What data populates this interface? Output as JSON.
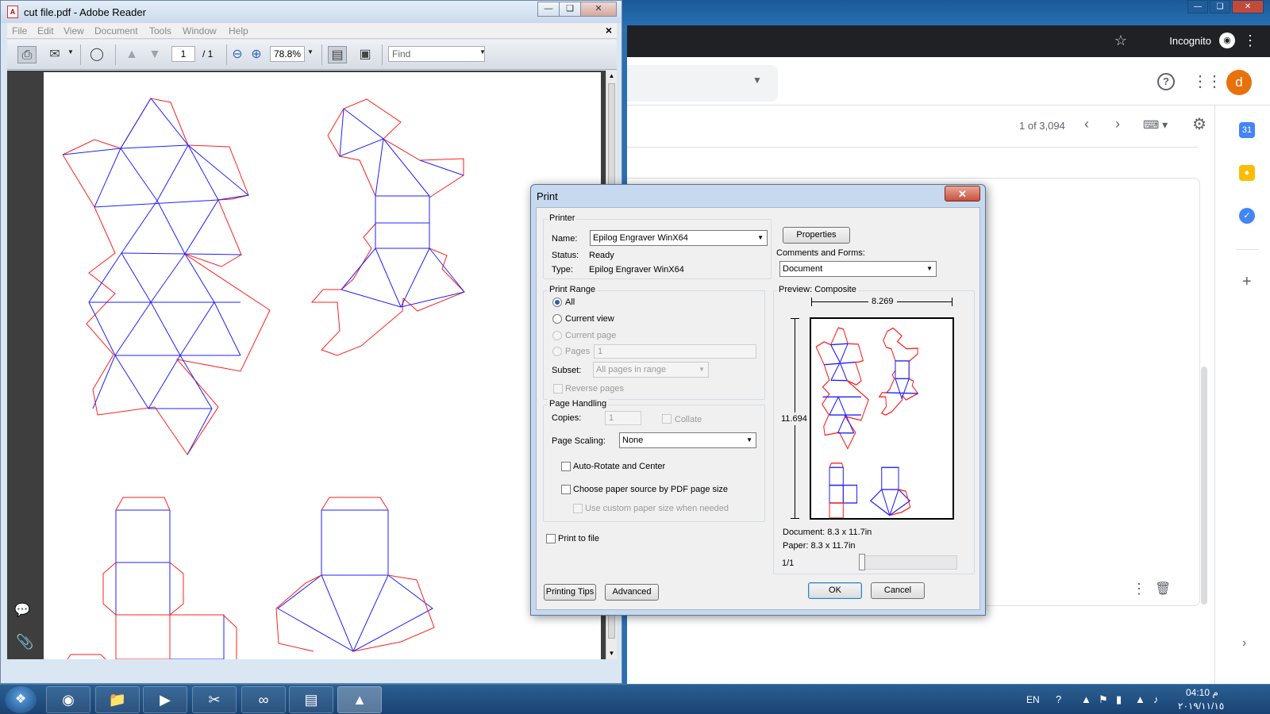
{
  "chrome": {
    "incognito_label": "Incognito",
    "avatar_letter": "d",
    "count_label": "1 of 3,094",
    "calendar_day": "31"
  },
  "reader": {
    "title": "cut file.pdf - Adobe Reader",
    "menu": [
      "File",
      "Edit",
      "View",
      "Document",
      "Tools",
      "Window",
      "Help"
    ],
    "page_current": "1",
    "page_total": "/ 1",
    "zoom": "78.8%",
    "find_placeholder": "Find"
  },
  "print": {
    "title": "Print",
    "printer_group": "Printer",
    "name_label": "Name:",
    "printer_name": "Epilog Engraver WinX64",
    "properties_button": "Properties",
    "status_label": "Status:",
    "status_value": "Ready",
    "type_label": "Type:",
    "type_value": "Epilog Engraver WinX64",
    "comments_label": "Comments and Forms:",
    "comments_value": "Document",
    "range_group": "Print Range",
    "range_all": "All",
    "range_current_view": "Current view",
    "range_current_page": "Current page",
    "range_pages": "Pages",
    "pages_value": "1",
    "subset_label": "Subset:",
    "subset_value": "All pages in range",
    "reverse_pages": "Reverse pages",
    "handling_group": "Page Handling",
    "copies_label": "Copies:",
    "copies_value": "1",
    "collate": "Collate",
    "scaling_label": "Page Scaling:",
    "scaling_value": "None",
    "auto_rotate": "Auto-Rotate and Center",
    "paper_source": "Choose paper source by PDF page size",
    "custom_paper": "Use custom paper size when needed",
    "print_to_file": "Print to file",
    "preview_label": "Preview: Composite",
    "preview_width": "8.269",
    "preview_height": "11.694",
    "document_size": "Document: 8.3 x 11.7in",
    "paper_size": "Paper: 8.3 x 11.7in",
    "page_indicator": "1/1",
    "printing_tips_button": "Printing Tips",
    "advanced_button": "Advanced",
    "ok_button": "OK",
    "cancel_button": "Cancel"
  },
  "taskbar": {
    "language": "EN",
    "time": "04:10 م",
    "date": "٢٠١٩/١١/١٥"
  },
  "colors": {
    "cut_line": "#ff2020",
    "fold_line": "#2020ff",
    "chrome_avatar": "#e8710a"
  }
}
